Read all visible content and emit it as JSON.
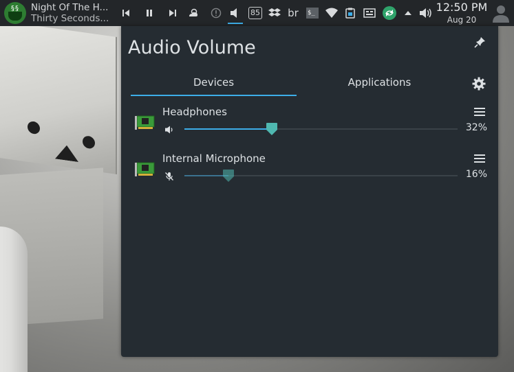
{
  "media": {
    "title": "Night Of The H...",
    "artist": "Thirty Seconds..."
  },
  "tray": {
    "badge_value": "85",
    "keyboard_layout": "br"
  },
  "clock": {
    "time": "12:50 PM",
    "date": "Aug 20"
  },
  "popup": {
    "title": "Audio Volume",
    "tabs": [
      {
        "label": "Devices",
        "active": true
      },
      {
        "label": "Applications",
        "active": false
      }
    ],
    "devices": [
      {
        "name": "Headphones",
        "percent_text": "32%",
        "level": 0.32,
        "muted": false
      },
      {
        "name": "Internal Microphone",
        "percent_text": "16%",
        "level": 0.16,
        "muted": true
      }
    ]
  },
  "colors": {
    "accent": "#3daee9",
    "slider_handle": "#4fb8b0",
    "panel_bg": "#232629",
    "popup_bg": "#252c32"
  }
}
